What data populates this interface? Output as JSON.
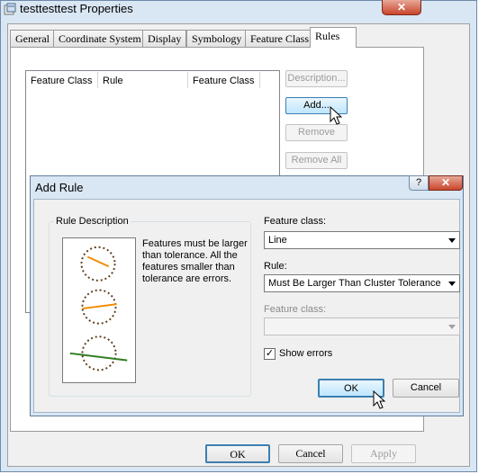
{
  "properties_window": {
    "title": "testtesttest  Properties",
    "close_glyph": "✕",
    "tabs": [
      {
        "label": "General"
      },
      {
        "label": "Coordinate System"
      },
      {
        "label": "Display"
      },
      {
        "label": "Symbology"
      },
      {
        "label": "Feature Class"
      },
      {
        "label": "Rules"
      }
    ],
    "active_tab": "Rules",
    "rules_list": {
      "columns": [
        "Feature Class",
        "Rule",
        "Feature Class"
      ],
      "rows": []
    },
    "side_buttons": {
      "description": "Description...",
      "add": "Add...",
      "remove": "Remove",
      "remove_all": "Remove All"
    },
    "footer_buttons": {
      "ok": "OK",
      "cancel": "Cancel",
      "apply": "Apply"
    }
  },
  "add_rule_dialog": {
    "title": "Add Rule",
    "help_glyph": "?",
    "close_glyph": "✕",
    "rule_description": {
      "group_label": "Rule Description",
      "text": "Features must be larger than tolerance. All the features smaller than tolerance are errors."
    },
    "feature_class_label": "Feature class:",
    "feature_class_value": "Line",
    "rule_label": "Rule:",
    "rule_value": "Must Be Larger Than Cluster Tolerance",
    "feature_class2_label": "Feature class:",
    "feature_class2_value": "",
    "show_errors_label": "Show errors",
    "show_errors_checked": true,
    "ok_label": "OK",
    "cancel_label": "Cancel"
  },
  "colors": {
    "preview_circle": "#5a3b1a",
    "preview_line_orange": "#f08c00",
    "preview_line_green": "#2e7d1e",
    "accent": "#3c7fb1"
  },
  "icons": [
    "properties-window-icon",
    "close-icon",
    "help-icon",
    "mouse-pointer-icon",
    "dropdown-arrow-icon",
    "checkmark-icon"
  ]
}
